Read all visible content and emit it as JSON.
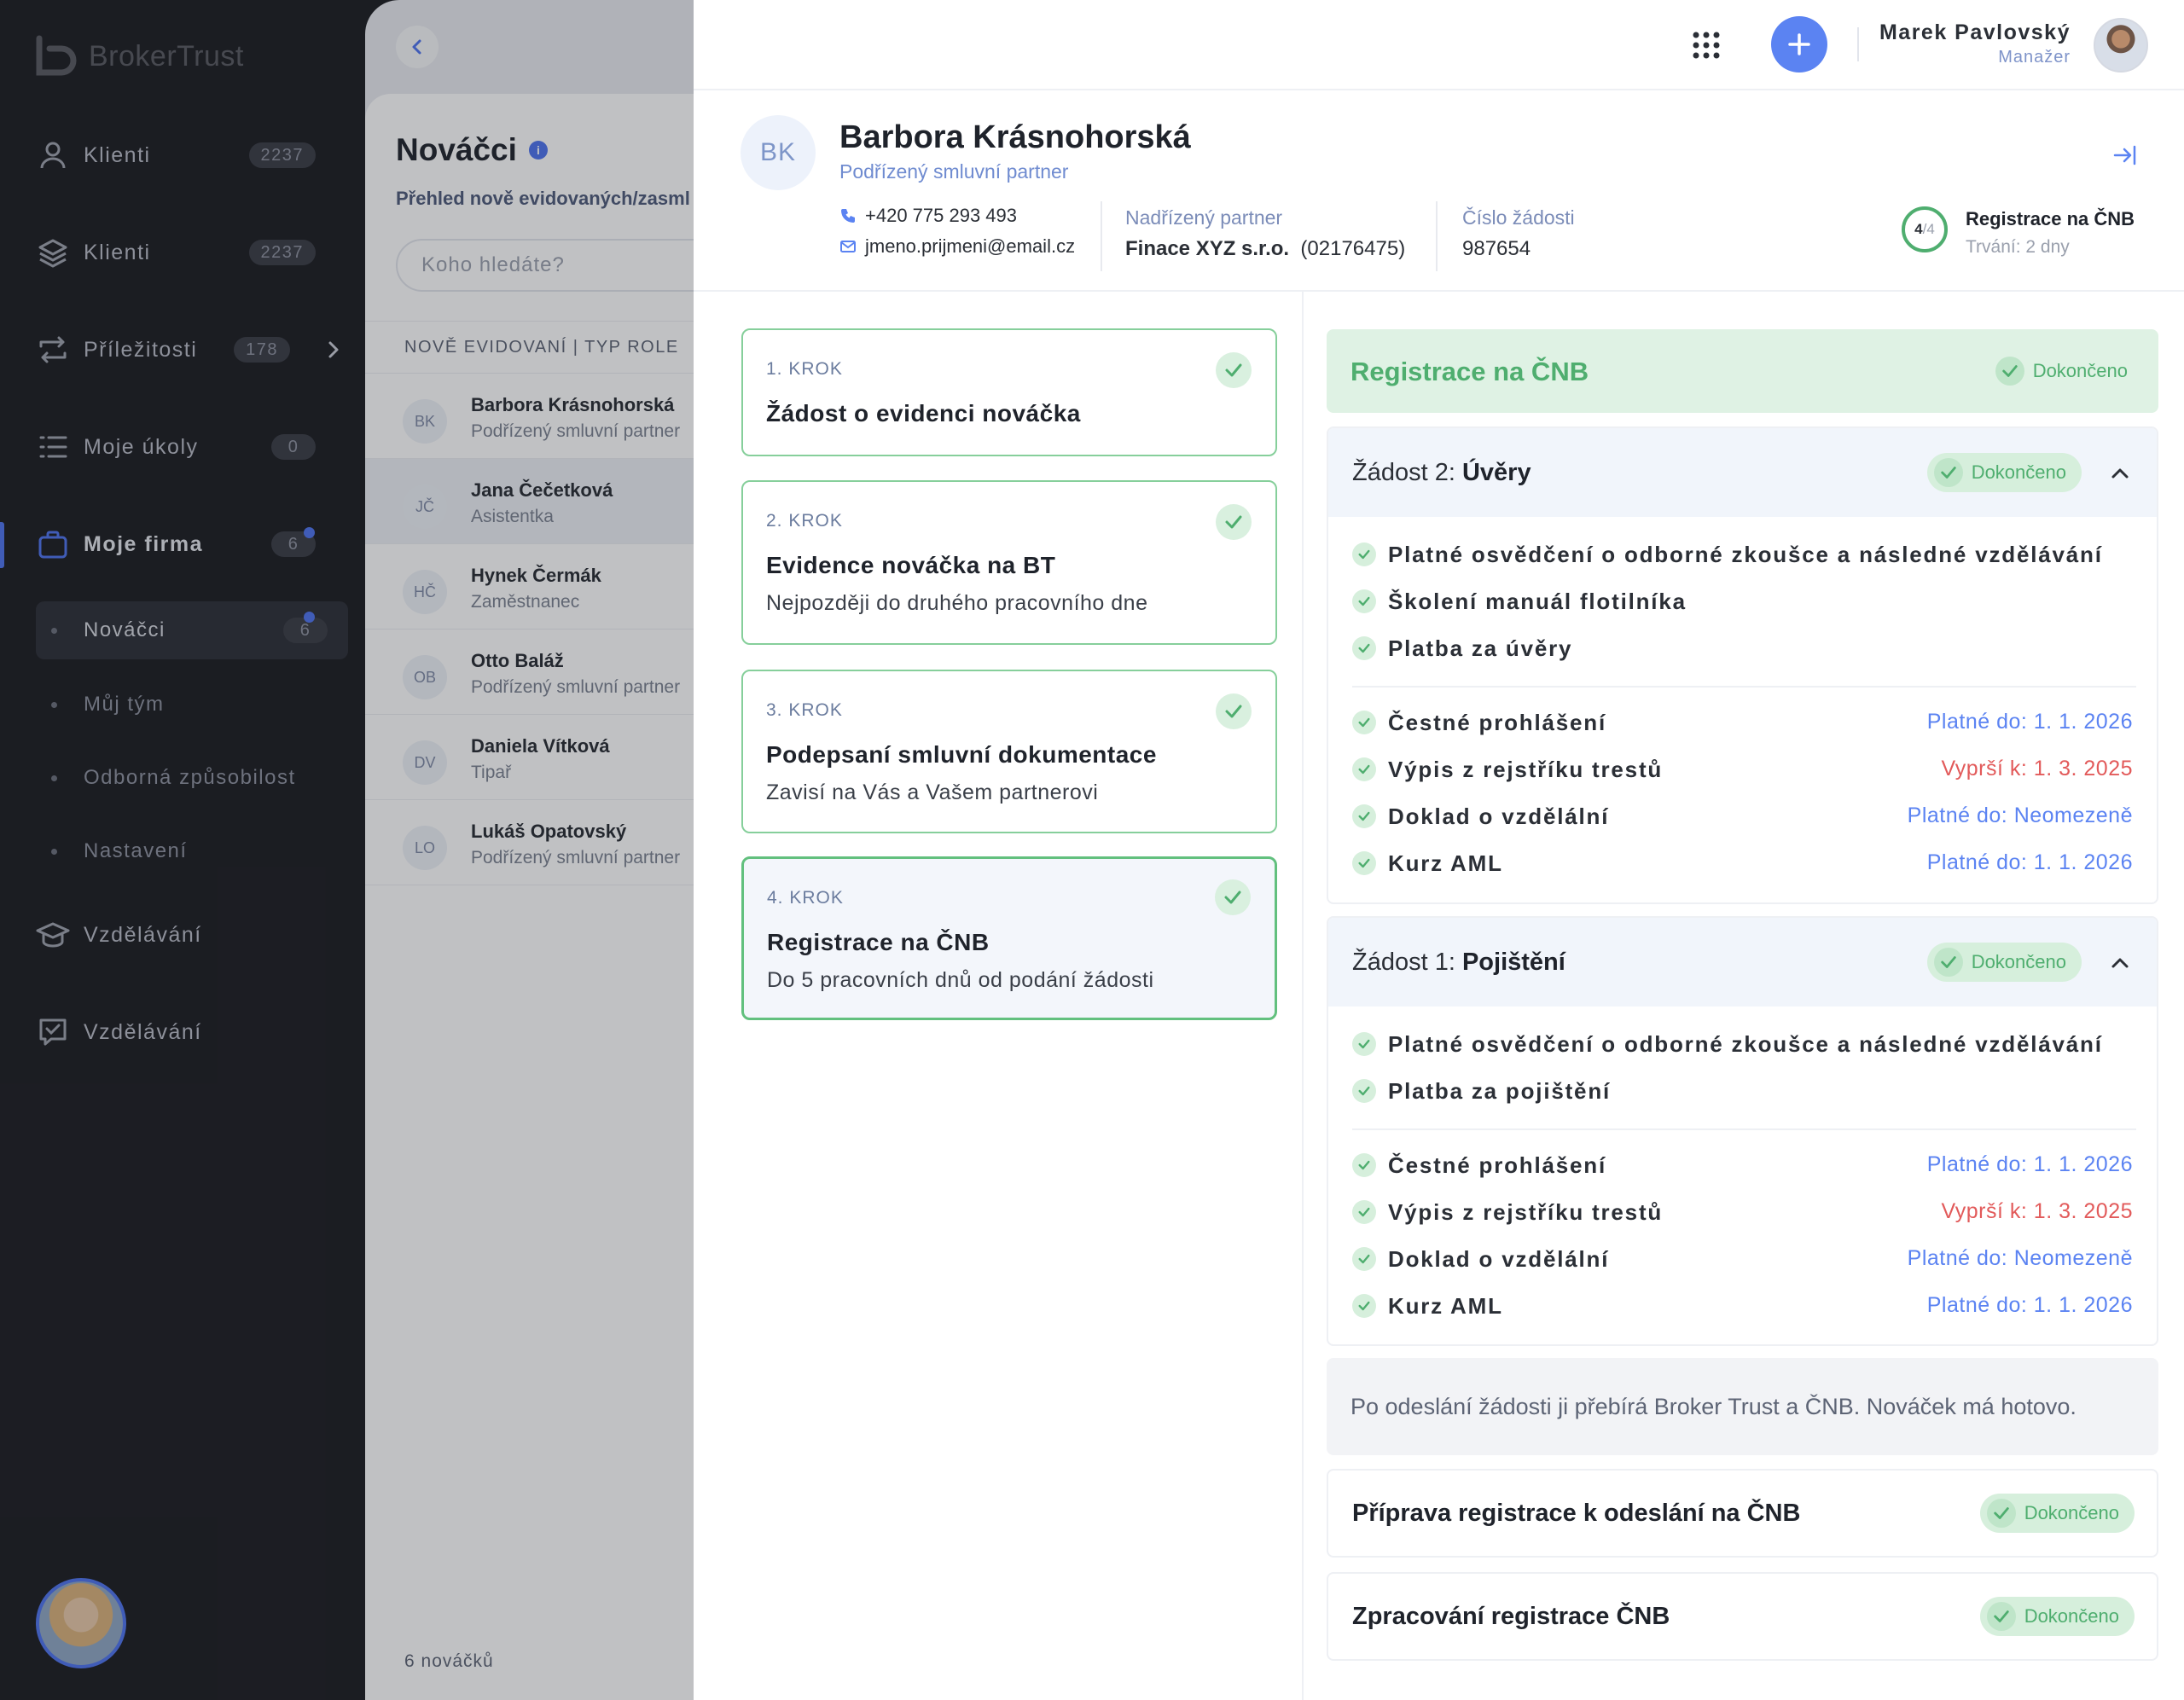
{
  "app": {
    "logo_text": "BrokerTrust"
  },
  "sidebar": {
    "items": [
      {
        "label": "Klienti",
        "count": "2237",
        "icon": "user-icon"
      },
      {
        "label": "Klienti",
        "count": "2237",
        "icon": "layers-icon"
      },
      {
        "label": "Příležitosti",
        "count": "178",
        "icon": "arrows-icon"
      },
      {
        "label": "Moje úkoly",
        "count": "0",
        "icon": "list-icon"
      },
      {
        "label": "Moje firma",
        "count": "6",
        "icon": "briefcase-icon"
      },
      {
        "label": "Vzdělávání",
        "icon": "graduation-cap-icon"
      },
      {
        "label": "Vzdělávání",
        "icon": "chat-icon"
      }
    ],
    "sub_items": [
      {
        "label": "Nováčci",
        "count": "6"
      },
      {
        "label": "Můj tým"
      },
      {
        "label": "Odborná způsobilost"
      },
      {
        "label": "Nastavení"
      }
    ]
  },
  "list": {
    "title": "Nováčci",
    "subtitle": "Přehled nově evidovaných/zasml",
    "search_placeholder": "Koho hledáte?",
    "column_header": "NOVĚ EVIDOVANÍ | TYP ROLE",
    "rows": [
      {
        "initials": "BK",
        "name": "Barbora Krásnohorská",
        "role": "Podřízený smluvní partner"
      },
      {
        "initials": "JČ",
        "name": "Jana Čečetková",
        "role": "Asistentka"
      },
      {
        "initials": "HČ",
        "name": "Hynek Čermák",
        "role": "Zaměstnanec"
      },
      {
        "initials": "OB",
        "name": "Otto Baláž",
        "role": "Podřízený smluvní partner"
      },
      {
        "initials": "DV",
        "name": "Daniela Vítková",
        "role": "Tipař"
      },
      {
        "initials": "LO",
        "name": "Lukáš Opatovský",
        "role": "Podřízený smluvní partner"
      }
    ],
    "footer": "6 nováčků"
  },
  "topbar": {
    "user_name": "Marek Pavlovský",
    "user_role": "Manažer"
  },
  "person": {
    "initials": "BK",
    "name": "Barbora Krásnohorská",
    "role": "Podřízený smluvní partner",
    "phone": "+420 775 293 493",
    "email": "jmeno.prijmeni@email.cz",
    "superior_label": "Nadřízený partner",
    "superior_name": "Finace XYZ s.r.o.",
    "superior_id": "(02176475)",
    "request_label": "Číslo žádosti",
    "request_number": "987654",
    "progress_done": "4",
    "progress_total": "/4",
    "progress_fraction": 1.0,
    "progress_title": "Registrace na ČNB",
    "progress_duration": "Trvání: 2 dny"
  },
  "steps": [
    {
      "kicker": "1. KROK",
      "title": "Žádost o evidenci nováčka",
      "desc": ""
    },
    {
      "kicker": "2. KROK",
      "title": "Evidence nováčka na BT",
      "desc": "Nejpozději do druhého pracovního dne"
    },
    {
      "kicker": "3. KROK",
      "title": "Podepsaní smluvní dokumentace",
      "desc": "Zavisí na Vás a Vašem partnerovi"
    },
    {
      "kicker": "4. KROK",
      "title": "Registrace na ČNB",
      "desc": "Do 5 pracovních dnů od podání žádosti"
    }
  ],
  "detail": {
    "section_title": "Registrace na ČNB",
    "status_done": "Dokončeno",
    "cards": [
      {
        "prefix": "Žádost 2: ",
        "name": "Úvěry",
        "requirements": [
          "Platné osvědčení o odborné zkoušce a následné vzdělávání",
          "Školení manuál flotilníka",
          "Platba za úvěry"
        ],
        "documents": [
          {
            "label": "Čestné prohlášení",
            "date": "Platné do: 1. 1. 2026"
          },
          {
            "label": "Výpis z rejstříku trestů",
            "date": "Vyprší k: 1. 3. 2025"
          },
          {
            "label": "Doklad o vzdělální",
            "date": "Platné do: Neomezeně"
          },
          {
            "label": "Kurz AML",
            "date": "Platné do: 1. 1. 2026"
          }
        ]
      },
      {
        "prefix": "Žádost 1: ",
        "name": "Pojištění",
        "requirements": [
          "Platné osvědčení o odborné zkoušce a následné vzdělávání",
          "Platba za pojištění"
        ],
        "documents": [
          {
            "label": "Čestné prohlášení",
            "date": "Platné do: 1. 1. 2026"
          },
          {
            "label": "Výpis z rejstříku trestů",
            "date": "Vyprší k: 1. 3. 2025"
          },
          {
            "label": "Doklad o vzdělální",
            "date": "Platné do: Neomezeně"
          },
          {
            "label": "Kurz AML",
            "date": "Platné do: 1. 1. 2026"
          }
        ]
      }
    ],
    "note": "Po odeslání žádosti ji přebírá Broker Trust a ČNB. Nováček má hotovo.",
    "stages": [
      {
        "title": "Příprava registrace k odeslání na ČNB"
      },
      {
        "title": "Zpracování registrace ČNB"
      }
    ]
  },
  "colors": {
    "accent": "#5b83f2",
    "success": "#4fae6f",
    "danger": "#e25a5a",
    "sidebar_bg": "#1b1c21"
  }
}
